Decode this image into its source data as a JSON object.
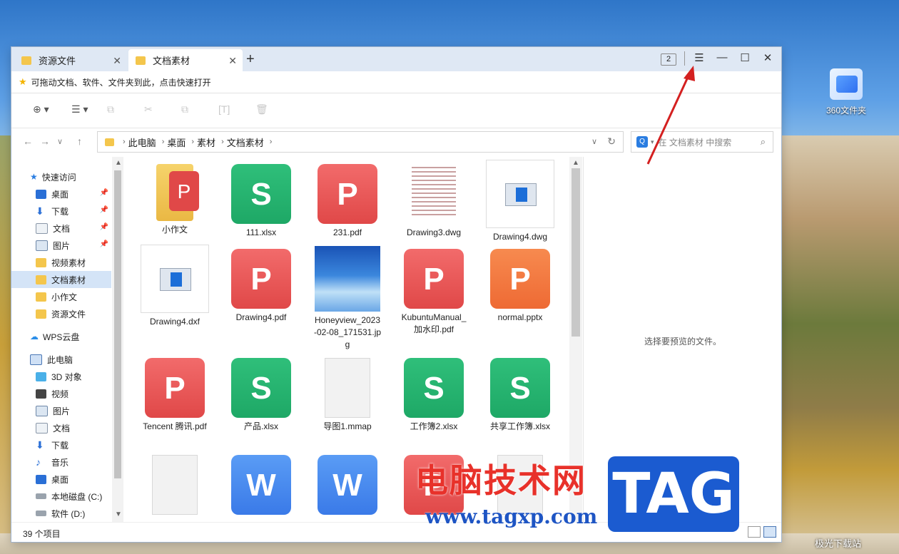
{
  "desktop": {
    "shortcut_label": "360文件夹",
    "corner_watermark": "极光下载站"
  },
  "tabs": [
    {
      "label": "资源文件"
    },
    {
      "label": "文档素材"
    }
  ],
  "window_controls": {
    "tab_count": "2"
  },
  "hint": "可拖动文档、软件、文件夹到此，点击快速打开",
  "breadcrumb": [
    "此电脑",
    "桌面",
    "素材",
    "文档素材"
  ],
  "search": {
    "placeholder": "在 文档素材 中搜索"
  },
  "sidebar": {
    "quick_access": "快速访问",
    "quick_items": [
      "桌面",
      "下载",
      "文档",
      "图片",
      "视频素材",
      "文档素材",
      "小作文",
      "资源文件"
    ],
    "wps_cloud": "WPS云盘",
    "this_pc": "此电脑",
    "pc_items": [
      "3D 对象",
      "视频",
      "图片",
      "文档",
      "下载",
      "音乐",
      "桌面",
      "本地磁盘 (C:)",
      "软件 (D:)"
    ]
  },
  "files": [
    {
      "name": "小作文",
      "type": "folder"
    },
    {
      "name": "111.xlsx",
      "type": "xlsx"
    },
    {
      "name": "231.pdf",
      "type": "pdf"
    },
    {
      "name": "Drawing3.dwg",
      "type": "doc-preview"
    },
    {
      "name": "Drawing4.dwg",
      "type": "cad"
    },
    {
      "name": "Drawing4.dxf",
      "type": "cad"
    },
    {
      "name": "Drawing4.pdf",
      "type": "pdf"
    },
    {
      "name": "Honeyview_2023-02-08_171531.jpg",
      "type": "image"
    },
    {
      "name": "KubuntuManual_加水印.pdf",
      "type": "pdf"
    },
    {
      "name": "normal.pptx",
      "type": "pptx"
    },
    {
      "name": "Tencent 腾讯.pdf",
      "type": "pdf"
    },
    {
      "name": "产品.xlsx",
      "type": "xlsx"
    },
    {
      "name": "导图1.mmap",
      "type": "blank"
    },
    {
      "name": "工作簿2.xlsx",
      "type": "xlsx"
    },
    {
      "name": "共享工作簿.xlsx",
      "type": "xlsx"
    },
    {
      "name": "",
      "type": "blank"
    },
    {
      "name": "",
      "type": "docx"
    },
    {
      "name": "",
      "type": "docx"
    },
    {
      "name": "",
      "type": "pdf"
    },
    {
      "name": "",
      "type": "blank"
    }
  ],
  "preview": {
    "message": "选择要预览的文件。"
  },
  "status": {
    "count": "39 个项目"
  },
  "watermark": {
    "cn": "电脑技术网",
    "url": "www.tagxp.com",
    "tag": "TAG"
  }
}
